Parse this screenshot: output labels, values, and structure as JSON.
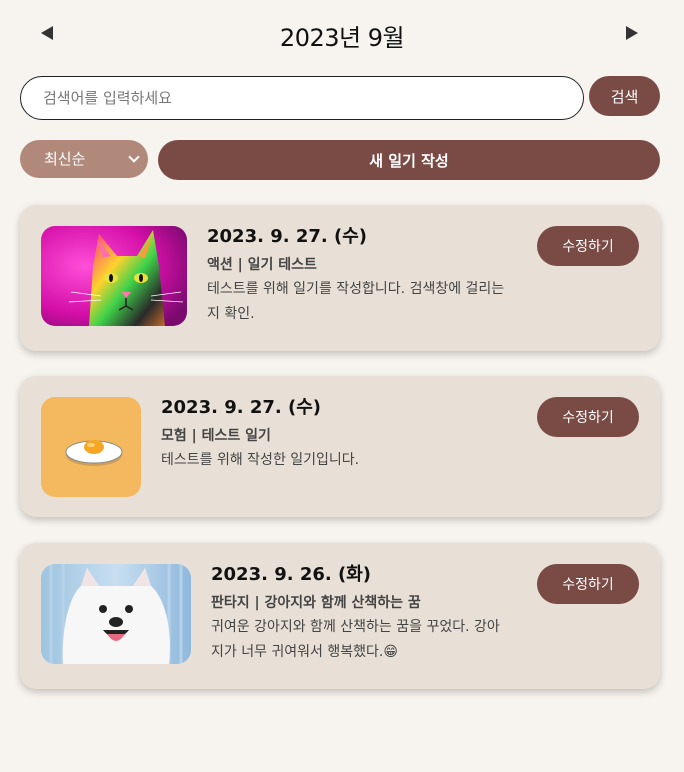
{
  "header": {
    "month_title": "2023년 9월"
  },
  "search": {
    "placeholder": "검색어를 입력하세요",
    "button_label": "검색"
  },
  "controls": {
    "sort_selected": "최신순",
    "new_entry_label": "새 일기 작성"
  },
  "colors": {
    "brand": "#7a4a45",
    "sort_bg": "#b0897a",
    "card_bg": "#e8e0d6",
    "page_bg": "#f7f4ef"
  },
  "entries": [
    {
      "date": "2023. 9. 27. (수)",
      "title": "액션 | 일기 테스트",
      "body": "테스트를 위해 일기를 작성합니다. 검색창에 걸리는지 확인.",
      "image": "colorful-cat-photo",
      "edit_label": "수정하기"
    },
    {
      "date": "2023. 9. 27. (수)",
      "title": "모험 | 테스트 일기",
      "body": "테스트를 위해 작성한 일기입니다.",
      "image": "fried-egg-icon",
      "edit_label": "수정하기"
    },
    {
      "date": "2023. 9. 26. (화)",
      "title": "판타지 | 강아지와 함께 산책하는 꿈",
      "body": "귀여운 강아지와 함께 산책하는 꿈을 꾸었다. 강아지가 너무 귀여워서 행복했다.😁",
      "image": "white-dog-photo",
      "edit_label": "수정하기"
    }
  ]
}
